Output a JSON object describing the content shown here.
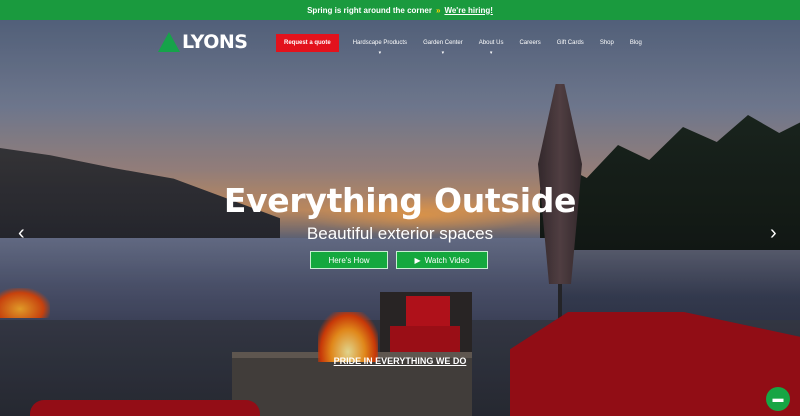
{
  "promo": {
    "text": "Spring is right around the corner",
    "arrow": "»",
    "link": "We're hiring!"
  },
  "logo": {
    "text": "LYONS",
    "icon": "tree-icon"
  },
  "nav": {
    "cta": "Request a quote",
    "items": [
      {
        "label": "Hardscape Products",
        "dropdown": true
      },
      {
        "label": "Garden Center",
        "dropdown": true
      },
      {
        "label": "About Us",
        "dropdown": true
      },
      {
        "label": "Careers",
        "dropdown": false
      },
      {
        "label": "Gift Cards",
        "dropdown": false
      },
      {
        "label": "Shop",
        "dropdown": false
      },
      {
        "label": "Blog",
        "dropdown": false
      }
    ]
  },
  "hero": {
    "title": "Everything Outside",
    "subtitle": "Beautiful exterior spaces",
    "buttons": {
      "how": "Here's How",
      "watch": "Watch Video"
    },
    "tagline": "PRIDE IN EVERYTHING WE DO"
  },
  "icons": {
    "prev": "chevron-left-icon",
    "next": "chevron-right-icon",
    "chat": "chat-icon",
    "play": "play-icon"
  },
  "colors": {
    "accent_green": "#1a9a3e",
    "accent_red": "#e3121c"
  }
}
